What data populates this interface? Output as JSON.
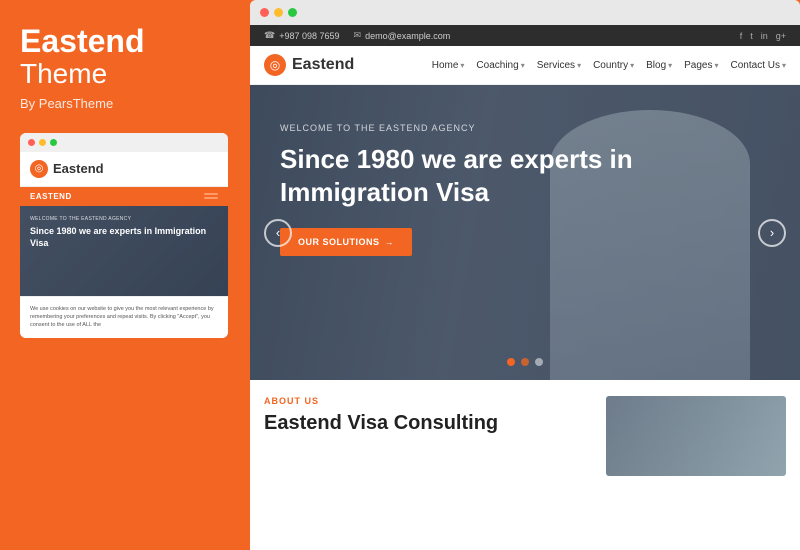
{
  "left": {
    "brand_bold": "Eastend",
    "brand_light": "Theme",
    "by_line": "By PearsTheme",
    "mini_browser": {
      "logo_text": "Eastend",
      "nav_title": "EASTEND",
      "welcome_text": "WELCOME TO THE EASTEND AGENCY",
      "hero_title": "Since 1980 we are experts in Immigration Visa",
      "cookie_text": "We use cookies on our website to give you the most relevant experience by remembering your preferences and repeat visits. By clicking \"Accept\", you consent to the use of ALL the"
    }
  },
  "right": {
    "topbar": {
      "phone": "+987 098 7659",
      "email": "demo@example.com",
      "socials": [
        "f",
        "t",
        "in",
        "g"
      ]
    },
    "nav": {
      "brand": "Eastend",
      "items": [
        {
          "label": "Home",
          "has_chevron": true
        },
        {
          "label": "Coaching",
          "has_chevron": true
        },
        {
          "label": "Services",
          "has_chevron": true
        },
        {
          "label": "Country",
          "has_chevron": true
        },
        {
          "label": "Blog",
          "has_chevron": true
        },
        {
          "label": "Pages",
          "has_chevron": true
        },
        {
          "label": "Contact Us",
          "has_chevron": true
        }
      ]
    },
    "hero": {
      "welcome": "WELCOME TO THE EASTEND AGENCY",
      "title": "Since 1980 we are experts in Immigration Visa",
      "button": "OUR SOLUTIONS",
      "arrow_left": "‹",
      "arrow_right": "›",
      "dots": [
        {
          "active": true
        },
        {
          "active": true
        },
        {
          "active": false
        }
      ]
    },
    "below": {
      "about_label": "ABOUT US",
      "about_title": "Eastend Visa Consulting"
    }
  },
  "colors": {
    "orange": "#f26522",
    "dark": "#2d2d2d",
    "text": "#333"
  },
  "dots": {
    "d1": "#e05500",
    "d2": "#f26522",
    "d3": "rgba(255,255,255,0.45)"
  }
}
